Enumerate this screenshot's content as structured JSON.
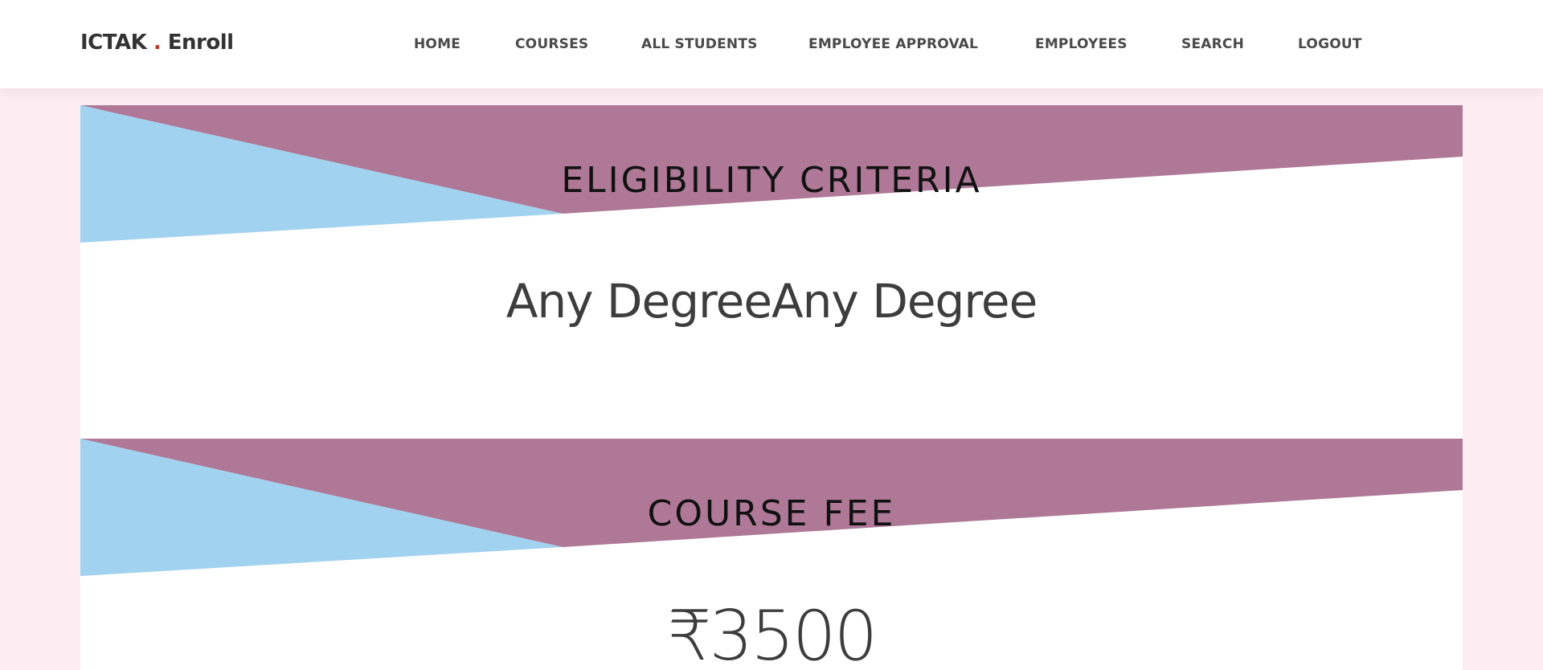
{
  "brand": {
    "name_start": "ICTAK",
    "dot": ".",
    "name_end": "Enroll"
  },
  "nav": {
    "items": [
      {
        "label": "HOME"
      },
      {
        "label": "COURSES"
      },
      {
        "label": "ALL STUDENTS"
      },
      {
        "label": "EMPLOYEE APPROVAL"
      },
      {
        "label": "EMPLOYEES"
      },
      {
        "label": "SEARCH"
      },
      {
        "label": "LOGOUT"
      }
    ]
  },
  "colors": {
    "banner_purple": "#ae7896",
    "banner_blue": "#a1d2f0",
    "page_background": "#fdedf2",
    "brand_dot": "#c0392b"
  },
  "sections": {
    "eligibility": {
      "heading": "ELIGIBILITY CRITERIA",
      "value": "Any DegreeAny Degree"
    },
    "fee": {
      "heading": "COURSE FEE",
      "currency_symbol": "₹",
      "amount": "3500"
    }
  }
}
